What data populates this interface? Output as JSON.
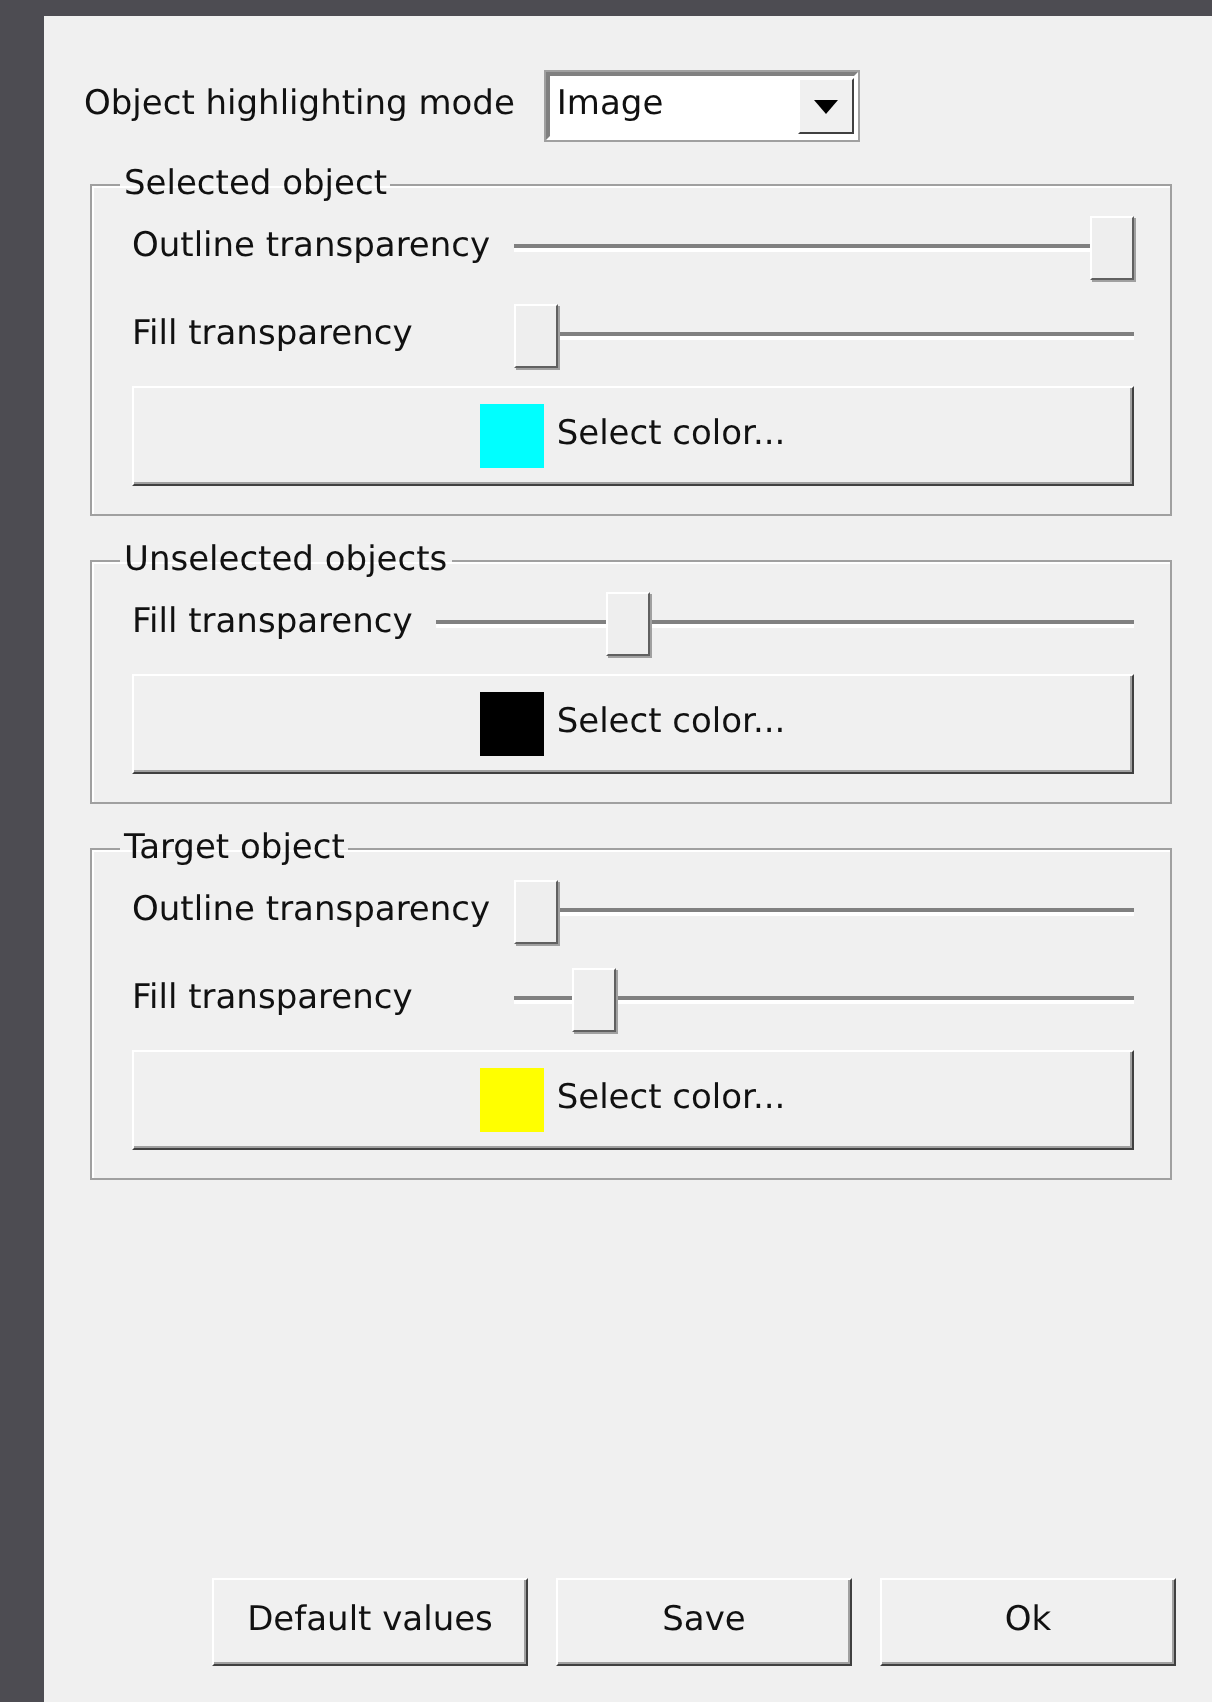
{
  "mode": {
    "label": "Object highlighting mode",
    "value": "Image"
  },
  "groups": [
    {
      "title": "Selected object",
      "sliders": [
        {
          "label": "Outline transparency",
          "level": 1.0
        },
        {
          "label": "Fill transparency",
          "level": 0.0
        }
      ],
      "color_button": {
        "label": "Select color...",
        "color": "#00ffff"
      }
    },
    {
      "title": "Unselected objects",
      "sliders": [
        {
          "label": "Fill transparency",
          "level": 0.26
        }
      ],
      "color_button": {
        "label": "Select color...",
        "color": "#000000"
      }
    },
    {
      "title": "Target object",
      "sliders": [
        {
          "label": "Outline transparency",
          "level": 0.0
        },
        {
          "label": "Fill transparency",
          "level": 0.1
        }
      ],
      "color_button": {
        "label": "Select color...",
        "color": "#ffff00"
      }
    }
  ],
  "buttons": [
    "Default values",
    "Save",
    "Ok"
  ]
}
